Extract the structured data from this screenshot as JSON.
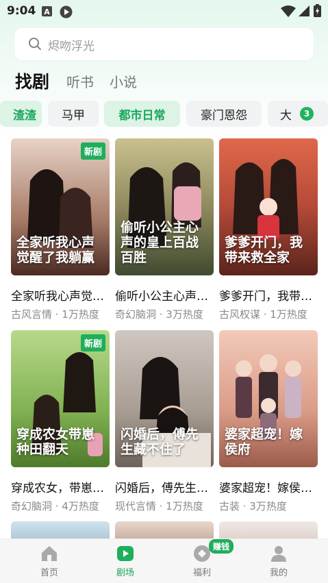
{
  "status_bar": {
    "time": "9:04"
  },
  "search": {
    "placeholder": "烬吻浮光"
  },
  "tabs": [
    {
      "label": "找剧",
      "active": true
    },
    {
      "label": "听书",
      "active": false
    },
    {
      "label": "小说",
      "active": false
    }
  ],
  "categories": {
    "items": [
      "渣渣",
      "马甲",
      "都市日常",
      "豪门恩怨",
      "大"
    ],
    "selected": "都市日常",
    "badge": "3"
  },
  "cards": [
    {
      "poster_title": "全家听我心声觉醒了我躺赢",
      "title": "全家听我心声觉…",
      "meta": "古风言情 · 1万热度",
      "badge": "新剧"
    },
    {
      "poster_title": "偷听小公主心声的皇上百战百胜",
      "title": "偷听小公主心声…",
      "meta": "奇幻脑洞 · 3万热度",
      "badge": ""
    },
    {
      "poster_title": "爹爹开门，我带来救全家",
      "title": "爹爹开门，我带…",
      "meta": "古风权谋 · 1万热度",
      "badge": ""
    },
    {
      "poster_title": "穿成农女带崽种田翻天",
      "title": "穿成农女，带崽…",
      "meta": "奇幻脑洞 · 4万热度",
      "badge": "新剧"
    },
    {
      "poster_title": "闪婚后，傅先生藏不住了",
      "title": "闪婚后，傅先生…",
      "meta": "现代言情 · 1万热度",
      "badge": ""
    },
    {
      "poster_title": "婆家超宠！嫁侯府",
      "title": "婆家超宠！嫁侯…",
      "meta": "古装 · 3万热度",
      "badge": ""
    }
  ],
  "bottom_nav": {
    "items": [
      {
        "label": "首页",
        "icon": "home-icon",
        "active": false
      },
      {
        "label": "剧场",
        "icon": "theater-play-icon",
        "active": true
      },
      {
        "label": "福利",
        "icon": "gift-icon",
        "active": false
      },
      {
        "label": "我的",
        "icon": "profile-icon",
        "active": false
      }
    ],
    "earn_badge": "赚钱"
  },
  "colors": {
    "accent": "#1fae5c",
    "text": "#111111",
    "muted": "#8a8a8a"
  }
}
